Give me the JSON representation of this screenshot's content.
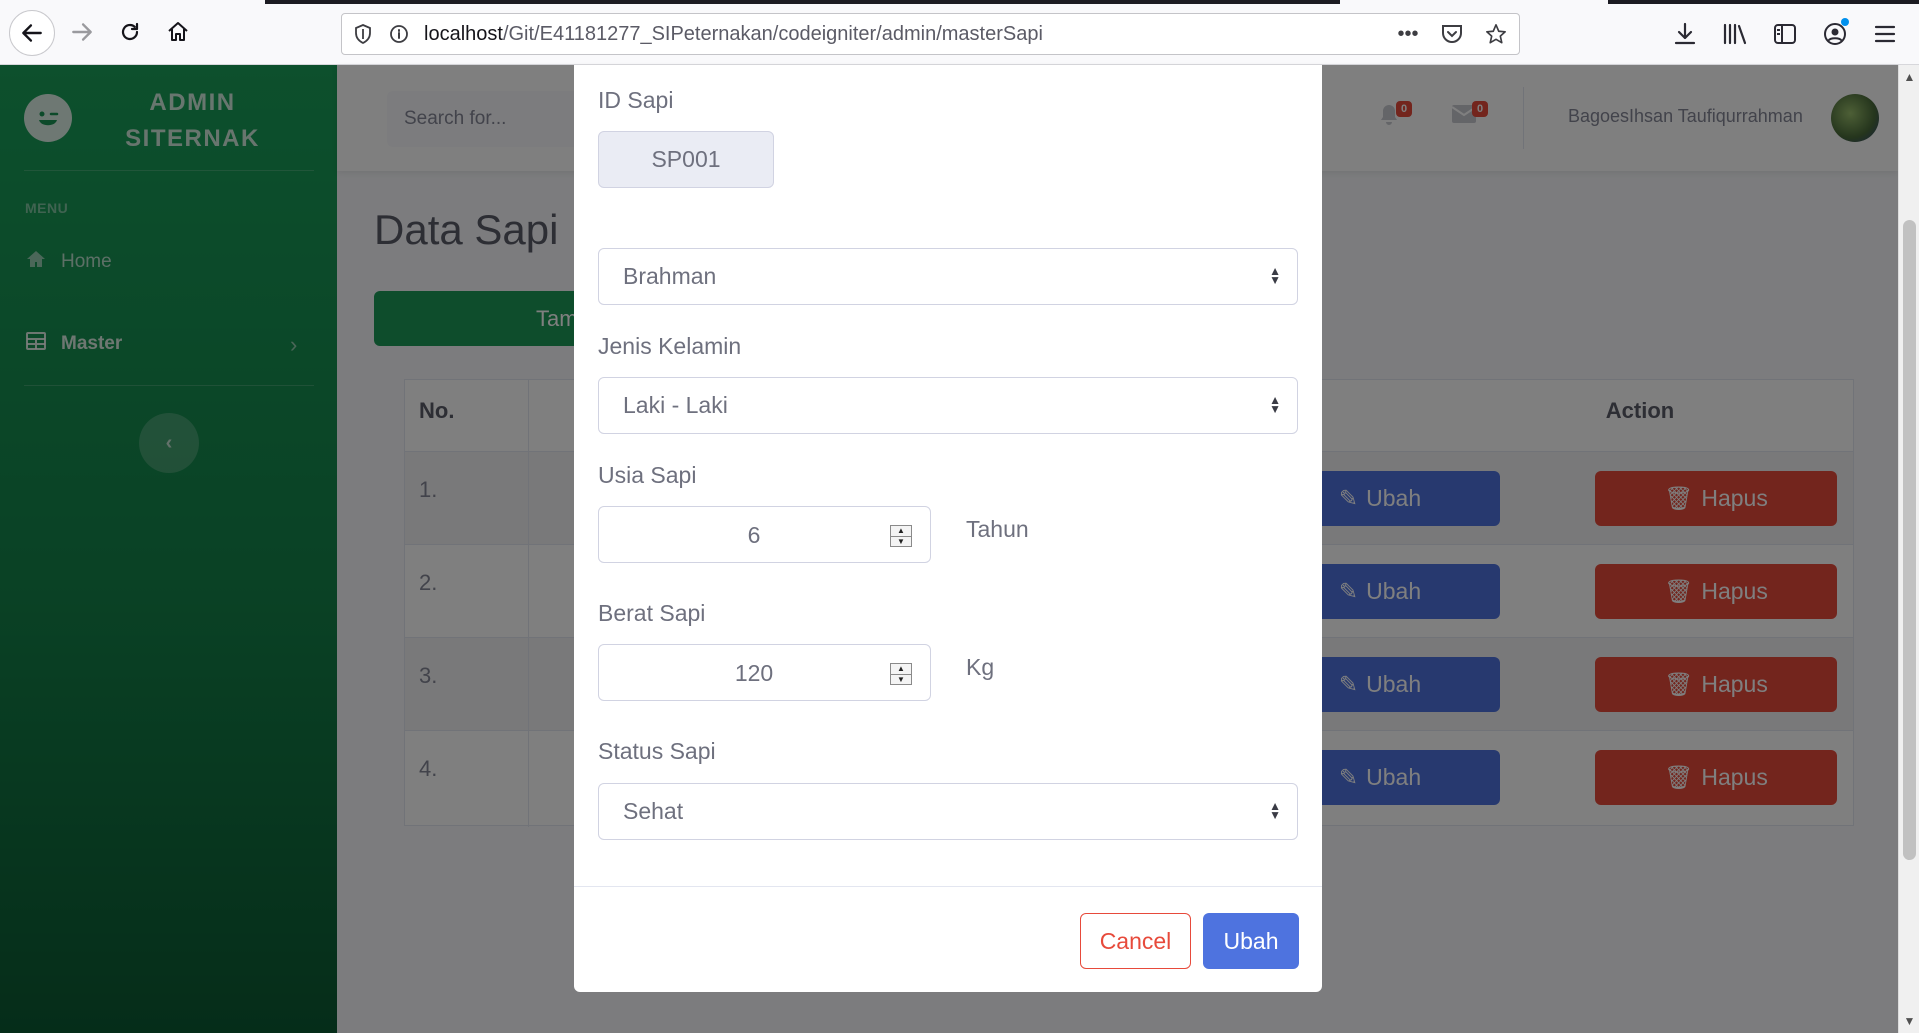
{
  "browser": {
    "url_host": "localhost",
    "url_path": "/Git/E41181277_SIPeternakan/codeigniter/admin/masterSapi",
    "icons": {
      "back": "back-arrow-icon",
      "forward": "forward-arrow-icon",
      "reload": "reload-icon",
      "home": "home-icon",
      "shield": "shield-icon",
      "info": "info-icon",
      "more": "more-icon",
      "pocket": "pocket-icon",
      "bookmark": "star-icon",
      "download": "download-icon",
      "library": "library-icon",
      "sidebar": "sidebar-icon",
      "account": "account-icon",
      "menu": "hamburger-menu-icon"
    },
    "colors": {
      "accent": "#0090ed"
    }
  },
  "sidebar": {
    "brand_line1": "ADMIN",
    "brand_line2": "SITERNAK",
    "heading": "MENU",
    "items": [
      {
        "label": "Home",
        "icon": "home-icon"
      },
      {
        "label": "Master",
        "icon": "table-icon"
      }
    ],
    "colors": {
      "top": "#1aa05a",
      "bottom": "#0b5a33"
    }
  },
  "topbar": {
    "search_placeholder": "Search for...",
    "alerts_count": "0",
    "messages_count": "0",
    "username": "BagoesIhsan Taufiqurrahman"
  },
  "main": {
    "page_title": "Data Sapi",
    "add_button": "Tamba",
    "table": {
      "headers": {
        "no": "No.",
        "action": "Action"
      },
      "rows": [
        {
          "no": "1."
        },
        {
          "no": "2."
        },
        {
          "no": "3."
        },
        {
          "no": "4."
        }
      ],
      "edit_label": "Ubah",
      "delete_label": "Hapus"
    },
    "colors": {
      "primary": "#4e73df",
      "danger": "#e74a3b",
      "success": "#1d9b58"
    }
  },
  "modal": {
    "id_label": "ID Sapi",
    "id_value": "SP001",
    "breed_value": "Brahman",
    "gender_label": "Jenis Kelamin",
    "gender_value": "Laki - Laki",
    "age_label": "Usia Sapi",
    "age_value": "6",
    "age_unit": "Tahun",
    "weight_label": "Berat Sapi",
    "weight_value": "120",
    "weight_unit": "Kg",
    "status_label": "Status Sapi",
    "status_value": "Sehat",
    "cancel_button": "Cancel",
    "submit_button": "Ubah"
  }
}
